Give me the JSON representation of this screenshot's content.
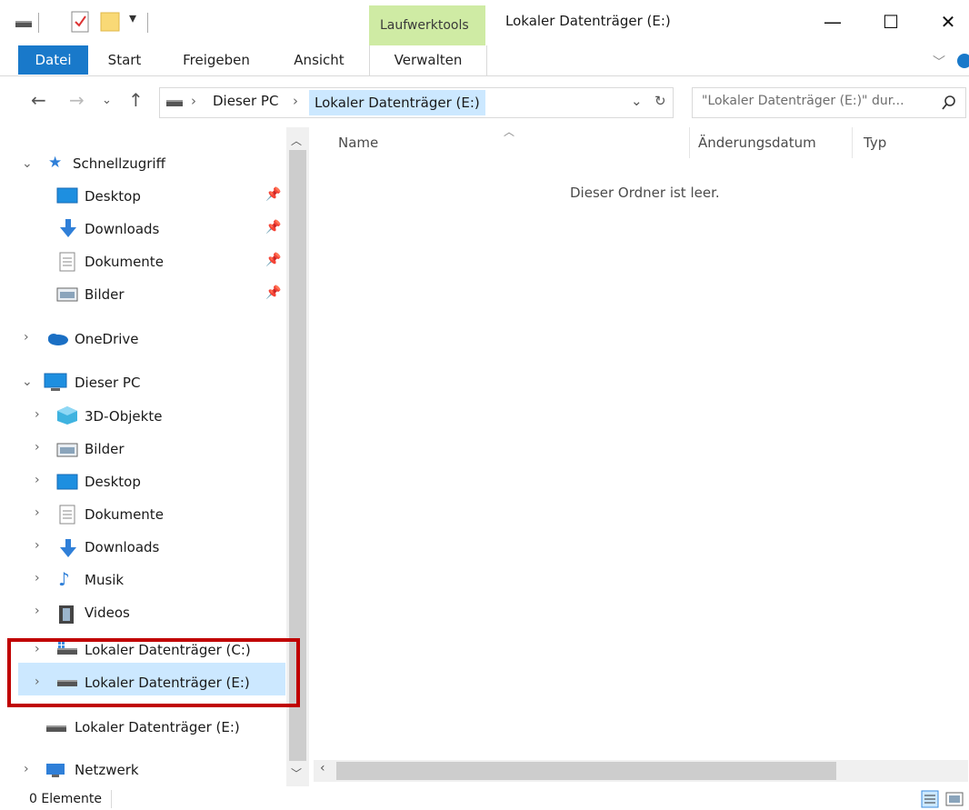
{
  "titlebar": {
    "context_tab": "Laufwerktools",
    "title": "Lokaler Datenträger (E:)",
    "minimize": "—",
    "maximize": "☐",
    "close": "✕"
  },
  "ribbon": {
    "tabs": [
      "Datei",
      "Start",
      "Freigeben",
      "Ansicht",
      "Verwalten"
    ]
  },
  "address": {
    "crumbs": [
      "Dieser PC",
      "Lokaler Datenträger (E:)"
    ],
    "search_placeholder": "\"Lokaler Datenträger (E:)\" dur..."
  },
  "nav": {
    "quick_access": "Schnellzugriff",
    "quick_items": [
      "Desktop",
      "Downloads",
      "Dokumente",
      "Bilder"
    ],
    "onedrive": "OneDrive",
    "this_pc": "Dieser PC",
    "pc_items": [
      "3D-Objekte",
      "Bilder",
      "Desktop",
      "Dokumente",
      "Downloads",
      "Musik",
      "Videos",
      "Lokaler Datenträger (C:)",
      "Lokaler Datenträger (E:)"
    ],
    "drive_e_root": "Lokaler Datenträger (E:)",
    "network": "Netzwerk"
  },
  "content": {
    "columns": [
      "Name",
      "Änderungsdatum",
      "Typ"
    ],
    "empty_message": "Dieser Ordner ist leer."
  },
  "status": {
    "count": "0 Elemente"
  },
  "colors": {
    "file_tab": "#1979ca",
    "context_tab": "#cfeba4",
    "selection": "#cce8ff",
    "highlight_box": "#c00000"
  }
}
